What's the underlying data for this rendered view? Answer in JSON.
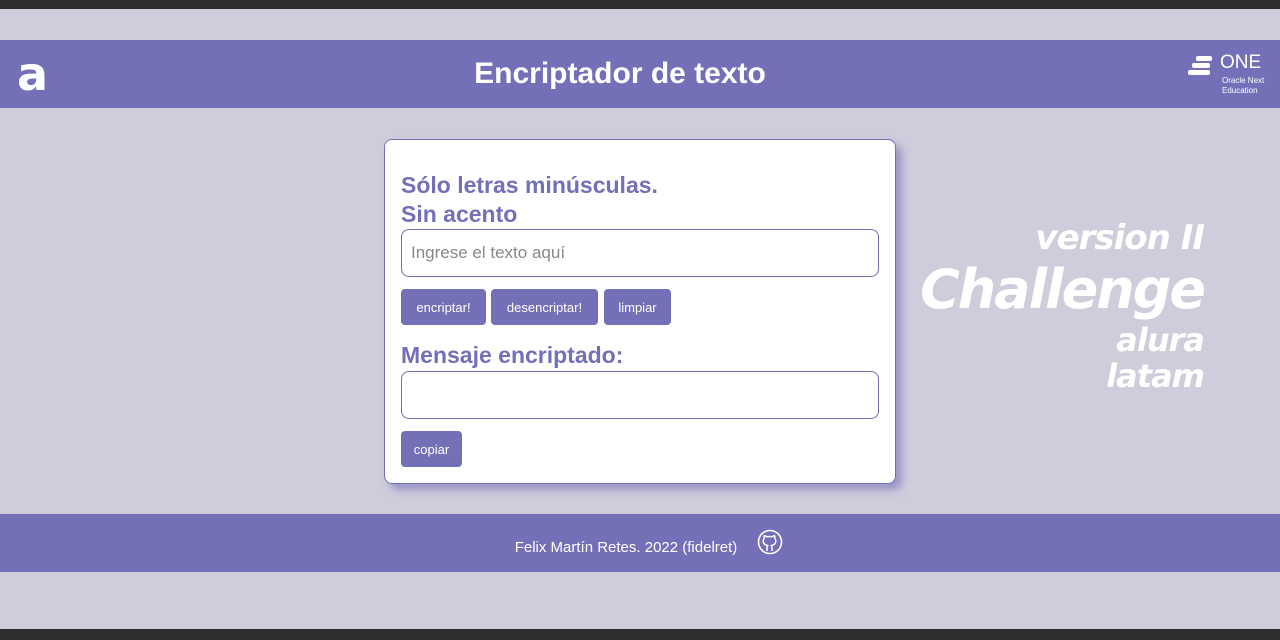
{
  "header": {
    "logo_letter": "a",
    "title": "Encriptador de texto",
    "one_logo": {
      "word": "ONE",
      "sub_line1": "Oracle Next",
      "sub_line2": "Education"
    }
  },
  "card": {
    "instructions_line1": "Sólo letras minúsculas.",
    "instructions_line2": "Sin acento",
    "input": {
      "placeholder": "Ingrese el texto aquí",
      "value": ""
    },
    "buttons": {
      "encrypt": "encriptar!",
      "decrypt": "desencriptar!",
      "clear": "limpiar"
    },
    "output_heading": "Mensaje encriptado:",
    "output_value": "",
    "copy_button": "copiar"
  },
  "side_text": {
    "version": "version II",
    "challenge": "Challenge",
    "alura": "alura",
    "latam": "latam"
  },
  "footer": {
    "credit": "Felix Martín Retes. 2022 (fidelret)",
    "github_icon": "github-icon"
  },
  "colors": {
    "background": "#cfcddc",
    "accent": "#7370b8",
    "white": "#ffffff"
  }
}
